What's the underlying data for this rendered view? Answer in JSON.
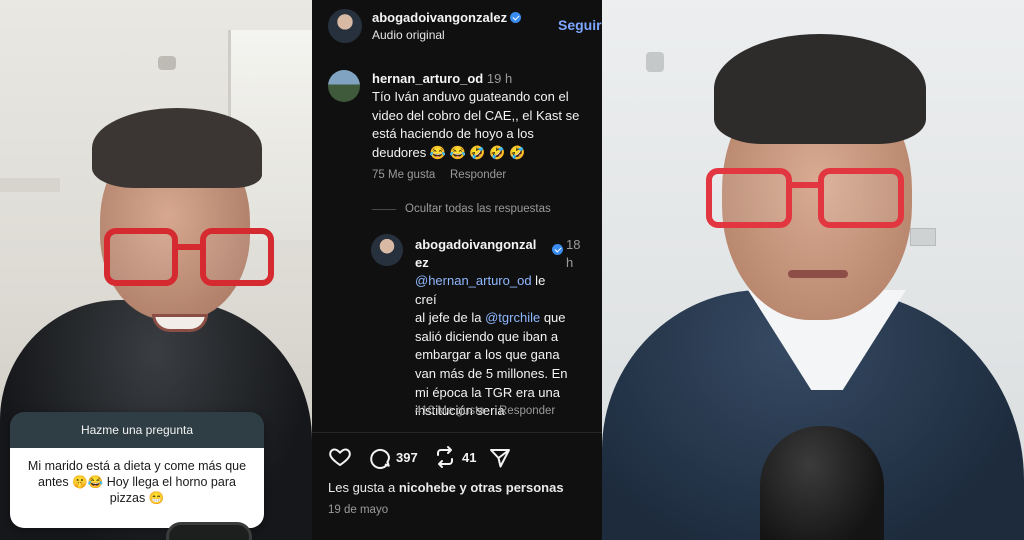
{
  "left_video": {
    "question_box": {
      "header": "Hazme una pregunta",
      "line1": "Mi marido está a dieta y come más que",
      "line2": "antes 🤫😂  Hoy llega el horno para",
      "line3": "pizzas 😁"
    }
  },
  "post": {
    "author": "abogadoivangonzalez",
    "verified": true,
    "audio_label": "Audio original",
    "follow_label": "Seguir"
  },
  "comment": {
    "author": "hernan_arturo_od",
    "time": "19 h",
    "lines": [
      "Tío Iván anduvo guateando con el",
      "video del cobro del CAE,, el Kast se",
      "está haciendo de hoyo a los",
      "deudores 😂 😂 🤣 🤣 🤣"
    ],
    "likes": "75 Me gusta",
    "reply_label": "Responder",
    "hide_replies": "Ocultar todas las respuestas"
  },
  "reply": {
    "author_line1": "abogadoivangonzal",
    "author_line2": "ez",
    "verified": true,
    "time_line1": "18",
    "time_line2": "h",
    "mention1": "@hernan_arturo_od",
    "line1_rest": " le",
    "line2": "creí",
    "line3_start": "al jefe de la ",
    "mention2": "@tgrchile",
    "line3_rest": " que",
    "line4": "salió diciendo que iban a",
    "line5": "embargar a los que gana",
    "line6": "van más de 5 millones. En",
    "line7": "mi época la TGR era una",
    "line8": "institución seria",
    "likes": "410 Me gusta",
    "reply_label": "Responder"
  },
  "actions": {
    "comments_count": "397",
    "reposts_count": "41"
  },
  "likes_summary": {
    "prefix": "Les gusta a ",
    "user": "nicohebe",
    "suffix": " y otras personas"
  },
  "date": "19 de mayo",
  "colors": {
    "background": "#101010",
    "link": "#8fb7ff",
    "verified": "#3a8cf0",
    "glasses": "#d62a31"
  },
  "icons": [
    "heart-icon",
    "comment-icon",
    "repost-icon",
    "share-icon",
    "verified-icon"
  ]
}
